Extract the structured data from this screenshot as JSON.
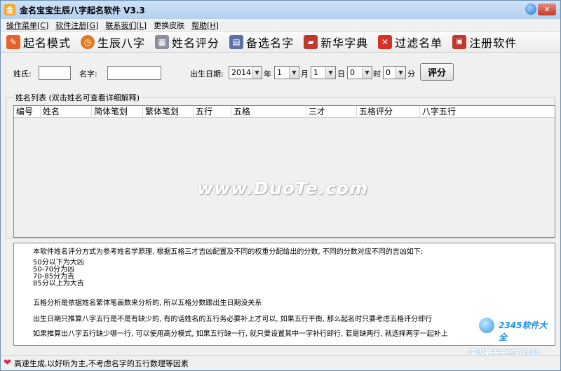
{
  "window": {
    "title": "金名宝宝生辰八字起名软件 V3.3",
    "app_icon_glyph": "金"
  },
  "menu": [
    {
      "label": "操作菜单[C]"
    },
    {
      "label": "软件注册[G]"
    },
    {
      "label": "联系我们[L]"
    },
    {
      "label": "更换皮肤"
    },
    {
      "label": "帮助[H]"
    }
  ],
  "toolbar": [
    {
      "label": "起名模式",
      "icon": "document-edit-icon",
      "color": "#e8602c",
      "glyph": "✎"
    },
    {
      "label": "生辰八字",
      "icon": "clock-icon",
      "color": "#e07b1f",
      "glyph": "◷"
    },
    {
      "label": "姓名评分",
      "icon": "calculator-icon",
      "color": "#8a8f9a",
      "glyph": "▦"
    },
    {
      "label": "备选名字",
      "icon": "calendar-icon",
      "color": "#5b6fa8",
      "glyph": "▤"
    },
    {
      "label": "新华字典",
      "icon": "folder-icon",
      "color": "#c0392b",
      "glyph": "▰"
    },
    {
      "label": "过滤名单",
      "icon": "delete-icon",
      "color": "#d9302a",
      "glyph": "✕"
    },
    {
      "label": "注册软件",
      "icon": "lock-icon",
      "color": "#c0392b",
      "glyph": "🔒"
    }
  ],
  "form": {
    "surname_label": "姓氏:",
    "surname_value": "",
    "name_label": "名字:",
    "name_value": "",
    "birth_label": "出生日期:",
    "year": "2014",
    "year_unit": "年",
    "month": "1",
    "month_unit": "月",
    "day": "1",
    "day_unit": "日",
    "hour": "0",
    "hour_unit": "时",
    "minute": "0",
    "minute_unit": "分",
    "score_button": "评分"
  },
  "list": {
    "group_title": "姓名列表 (双击姓名可查看详细解释)",
    "columns": [
      "编号",
      "姓名",
      "简体笔划",
      "繁体笔划",
      "五行",
      "五格",
      "三才",
      "五格评分",
      "八字五行"
    ],
    "rows": []
  },
  "watermark": "www.DuoTe.com",
  "info": {
    "intro": "本软件姓名评分方式为参考姓名学原理, 根据五格三才吉凶配置及不同的权重分配给出的分数, 不同的分数对应不同的吉凶如下:",
    "ranges": [
      "50分以下为大凶",
      "50-70分为凶",
      "70-85分为吉",
      "85分以上为大吉"
    ],
    "p2": "五格分析是依据姓名繁体笔画数来分析的, 所以五格分数跟出生日期没关系",
    "p3": "出生日期只推算八字五行是不是有缺少的, 有的话姓名的五行务必要补上才可以, 如果五行平衡, 那么起名时只要考虑五格评分即行",
    "p4": "如果推算出八字五行缺少哪一行, 可以使用高分模式, 如果五行缺一行, 就只要设置其中一字补行即行, 若是缺两行, 就选择两字一起补上"
  },
  "brand": {
    "top": "2345软件大全",
    "bottom": "国内最安全的软件站"
  },
  "status": {
    "text": "高速生成,以好听为主,不考虑名字的五行数理等因素"
  }
}
